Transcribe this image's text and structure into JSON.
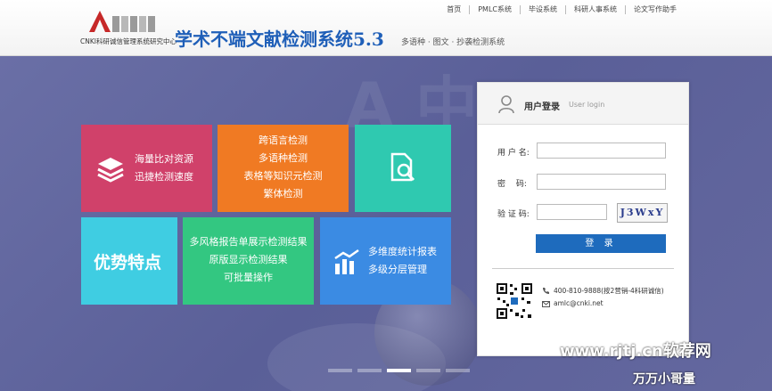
{
  "header": {
    "logo_caption": "CNKI科研诚信管理系统研究中心",
    "title": "学术不端文献检测系统5.3",
    "subtitle": "多语种 · 图文 · 抄袭检测系统",
    "nav": [
      "首页",
      "PMLC系统",
      "毕设系统",
      "科研人事系统",
      "论文写作助手"
    ]
  },
  "tiles": {
    "t1": [
      "海量比对资源",
      "迅捷检测速度"
    ],
    "t2": [
      "跨语言检测",
      "多语种检测",
      "表格等知识元检测",
      "繁体检测"
    ],
    "t4": "优势特点",
    "t5": [
      "多风格报告单展示检测结果",
      "原版显示检测结果",
      "可批量操作"
    ],
    "t6": [
      "多维度统计报表",
      "多级分层管理"
    ]
  },
  "login": {
    "title": "用户登录",
    "title_en": "User login",
    "username_label": "用 户 名:",
    "password_label": "密　 码:",
    "captcha_label": "验 证 码:",
    "captcha_text": "J3WxY",
    "submit_label": "登 录",
    "phone": "400-810-9888(按2营销-4科研诚信)",
    "email": "amlc@cnki.net"
  },
  "carousel": {
    "count": 5,
    "active_index": 2
  },
  "watermark": {
    "line1": "www.rjtj.cn软荐网",
    "line2": "万万小哥量"
  },
  "colors": {
    "tile1": "#d0416a",
    "tile2": "#f07a23",
    "tile3": "#2fc9b0",
    "tile4": "#3fcde2",
    "tile5": "#33c781",
    "tile6": "#3b8be3",
    "login_button": "#1e6bbd",
    "title": "#1f5fb8"
  }
}
